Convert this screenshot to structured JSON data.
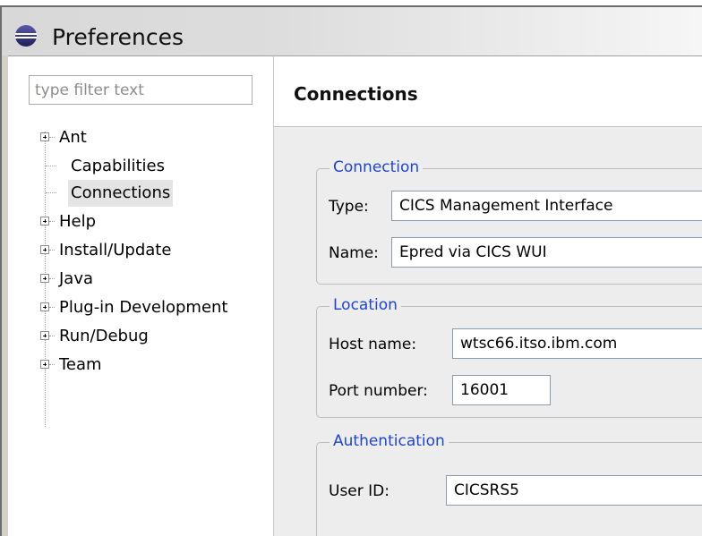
{
  "window": {
    "title": "Preferences",
    "icon": "eclipse-icon"
  },
  "sidebar": {
    "filter_placeholder": "type filter text",
    "items": [
      {
        "label": "Ant",
        "expandable": true
      },
      {
        "label": "Capabilities",
        "expandable": false
      },
      {
        "label": "Connections",
        "expandable": false,
        "selected": true
      },
      {
        "label": "Help",
        "expandable": true
      },
      {
        "label": "Install/Update",
        "expandable": true
      },
      {
        "label": "Java",
        "expandable": true
      },
      {
        "label": "Plug-in Development",
        "expandable": true
      },
      {
        "label": "Run/Debug",
        "expandable": true
      },
      {
        "label": "Team",
        "expandable": true
      }
    ]
  },
  "page": {
    "title": "Connections",
    "connection": {
      "legend": "Connection",
      "type_label": "Type:",
      "type_value": "CICS Management Interface",
      "name_label": "Name:",
      "name_value": "Epred via CICS WUI"
    },
    "location": {
      "legend": "Location",
      "host_label": "Host name:",
      "host_value": "wtsc66.itso.ibm.com",
      "port_label": "Port number:",
      "port_value": "16001"
    },
    "authentication": {
      "legend": "Authentication",
      "userid_label": "User ID:",
      "userid_value": "CICSRS5"
    }
  },
  "colors": {
    "group_legend": "#1f46c8",
    "selection": "#e4e4e4",
    "panel_bg": "#ededed"
  }
}
